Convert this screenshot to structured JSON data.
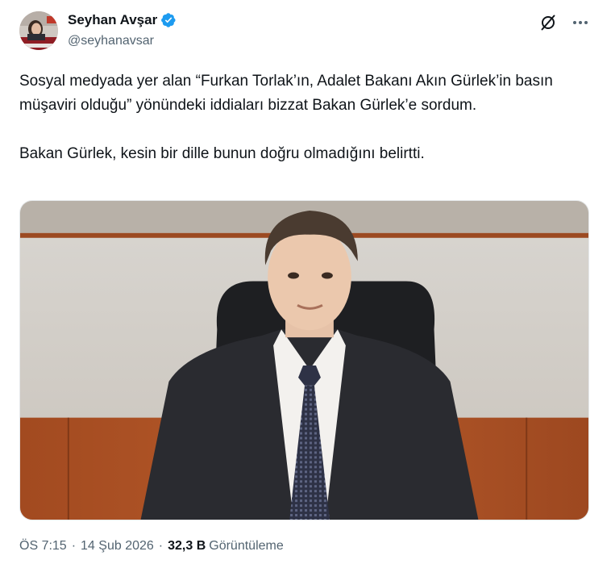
{
  "author": {
    "name": "Seyhan Avşar",
    "handle": "@seyhanavsar",
    "verified_color": "#1d9bf0"
  },
  "tweet": {
    "paragraphs": [
      "Sosyal medyada yer alan “Furkan Torlak’ın, Adalet Bakanı Akın Gürlek’in basın müşaviri olduğu” yönündeki iddiaları bizzat Bakan Gürlek’e sordum.",
      "Bakan Gürlek, kesin bir dille bunun doğru olmadığını belirtti."
    ]
  },
  "meta": {
    "time": "ÖS 7:15",
    "date": "14 Şub 2026",
    "separator": "·",
    "views_count": "32,3 B",
    "views_label": "Görüntüleme"
  },
  "icons": {
    "grok": "grok-icon",
    "more": "more-icon",
    "verified": "verified-badge-icon"
  }
}
